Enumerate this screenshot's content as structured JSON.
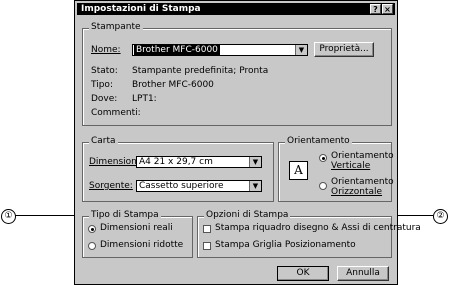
{
  "title": "Impostazioni di Stampa",
  "titlebar": {
    "help": "?",
    "close": "×"
  },
  "stampante": {
    "label": "Stampante",
    "nome_label": "Nome:",
    "nome_value": "Brother MFC-6000",
    "proprieta_button": "Proprietà...",
    "stato_label": "Stato:",
    "stato_value": "Stampante predefinita; Pronta",
    "tipo_label": "Tipo:",
    "tipo_value": "Brother MFC-6000",
    "dove_label": "Dove:",
    "dove_value": "LPT1:",
    "commenti_label": "Commenti:"
  },
  "carta": {
    "label": "Carta",
    "dimensioni_label": "Dimensioni:",
    "dimensioni_value": "A4 21 x 29,7 cm",
    "sorgente_label": "Sorgente:",
    "sorgente_value": "Cassetto superiore"
  },
  "orientamento": {
    "label": "Orientamento",
    "icon_letter": "A",
    "verticale_line1": "Orientamento",
    "verticale_line2": "Verticale",
    "orizzontale_line1": "Orientamento",
    "orizzontale_line2": "Orizzontale"
  },
  "tipo_stampa": {
    "label": "Tipo di Stampa",
    "reali": "Dimensioni reali",
    "ridotte": "Dimensioni ridotte"
  },
  "opzioni_stampa": {
    "label": "Opzioni di Stampa",
    "riquadro": "Stampa riquadro disegno & Assi di centratura",
    "griglia": "Stampa Griglia Posizionamento"
  },
  "buttons": {
    "ok": "OK",
    "annulla": "Annulla"
  },
  "callouts": {
    "one": "①",
    "two": "②"
  }
}
